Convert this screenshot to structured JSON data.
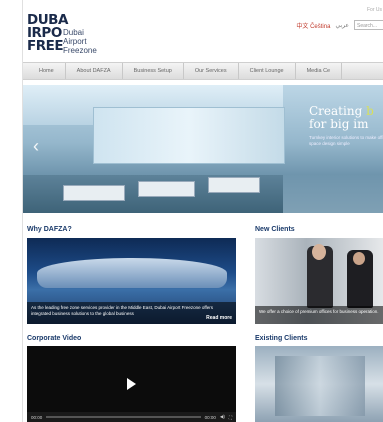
{
  "header": {
    "logo_lines": [
      "DUBA",
      "IRPO",
      "FREE"
    ],
    "logo_small": [
      "Dubai",
      "Airport",
      "Freezone"
    ],
    "top_text": "For Us",
    "lang_cn": "中文 Čeština",
    "lang_ar": "عربي",
    "search_placeholder": "Search..."
  },
  "nav": {
    "items": [
      "Home",
      "About DAFZA",
      "Business Setup",
      "Our Services",
      "Client Lounge",
      "Media Ce"
    ]
  },
  "hero": {
    "title_line1_prefix": "Creating ",
    "title_line1_highlight": "b",
    "title_line2": "for big im",
    "subtitle": "Turnkey interior solutions to make office space design simple"
  },
  "sections": {
    "why": {
      "heading": "Why DAFZA?",
      "caption": "As the leading free zone services provider in the Middle East, Dubai Airport Freezone offers integrated business solutions to the global business",
      "more": "Read more"
    },
    "new_clients": {
      "heading": "New Clients",
      "caption": "We offer a choice of premium offices for business operation."
    },
    "video": {
      "heading": "Corporate Video",
      "time_start": "00:00",
      "time_end": "00:00"
    },
    "existing": {
      "heading": "Existing Clients"
    }
  },
  "colors": {
    "heading_blue": "#1a3a6a",
    "highlight_yellow": "#d8e05a",
    "cn_link_red": "#c0392b"
  }
}
